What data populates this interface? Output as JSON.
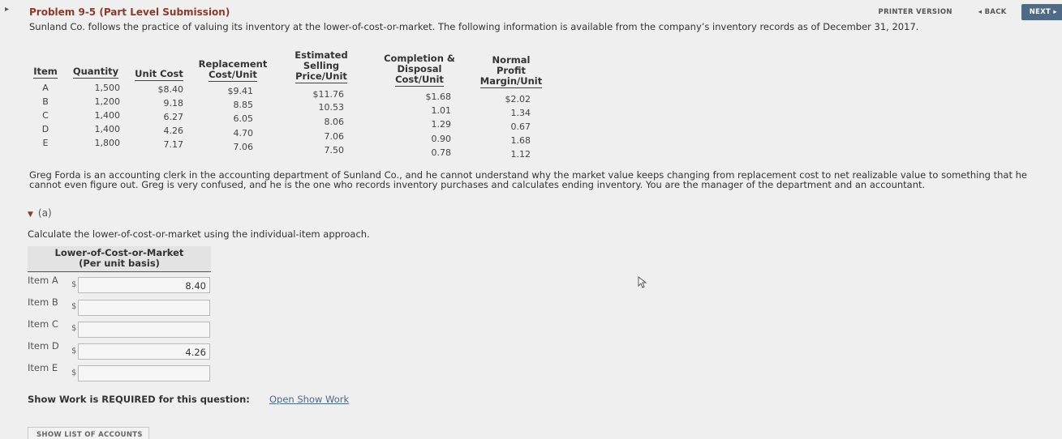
{
  "header": {
    "title": "Problem 9-5 (Part Level Submission)",
    "description": "Sunland Co. follows the practice of valuing its inventory at the lower-of-cost-or-market. The following information is available from the company’s inventory records as of December 31, 2017.",
    "printer_version": "PRINTER VERSION",
    "back": "◂ BACK",
    "next": "NEXT ▸"
  },
  "inventory_table": {
    "headers": {
      "item": "Item",
      "quantity": "Quantity",
      "unit_cost": "Unit Cost",
      "replacement_l1": "Replacement",
      "replacement_l2": "Cost/Unit",
      "esp_l1": "Estimated",
      "esp_l2": "Selling",
      "esp_l3": "Price/Unit",
      "cd_l1": "Completion &",
      "cd_l2": "Disposal",
      "cd_l3": "Cost/Unit",
      "npm_l1": "Normal",
      "npm_l2": "Profit",
      "npm_l3": "Margin/Unit"
    },
    "rows": [
      {
        "item": "A",
        "quantity": "1,500",
        "unit_cost": "$8.40",
        "replacement": "$9.41",
        "esp": "$11.76",
        "cd": "$1.68",
        "npm": "$2.02"
      },
      {
        "item": "B",
        "quantity": "1,200",
        "unit_cost": "9.18",
        "replacement": "8.85",
        "esp": "10.53",
        "cd": "1.01",
        "npm": "1.34"
      },
      {
        "item": "C",
        "quantity": "1,400",
        "unit_cost": "6.27",
        "replacement": "6.05",
        "esp": "8.06",
        "cd": "1.29",
        "npm": "0.67"
      },
      {
        "item": "D",
        "quantity": "1,400",
        "unit_cost": "4.26",
        "replacement": "4.70",
        "esp": "7.06",
        "cd": "0.90",
        "npm": "1.68"
      },
      {
        "item": "E",
        "quantity": "1,800",
        "unit_cost": "7.17",
        "replacement": "7.06",
        "esp": "7.50",
        "cd": "0.78",
        "npm": "1.12"
      }
    ]
  },
  "paragraph": "Greg Forda is an accounting clerk in the accounting department of Sunland Co., and he cannot understand why the market value keeps changing from replacement cost to net realizable value to something that he cannot even figure out. Greg is very confused, and he is the one who records inventory purchases and calculates ending inventory. You are the manager of the department and an accountant.",
  "part_a": {
    "label": "(a)",
    "instruction": "Calculate the lower-of-cost-or-market using the individual-item approach.",
    "table_header_l1": "Lower-of-Cost-or-Market",
    "table_header_l2": "(Per unit basis)",
    "currency": "$",
    "answers": [
      {
        "label": "Item A",
        "value": "8.40"
      },
      {
        "label": "Item B",
        "value": ""
      },
      {
        "label": "Item C",
        "value": ""
      },
      {
        "label": "Item D",
        "value": "4.26"
      },
      {
        "label": "Item E",
        "value": ""
      }
    ]
  },
  "show_work": {
    "label": "Show Work is REQUIRED for this question:",
    "link": "Open Show Work"
  },
  "list_accounts_button": "SHOW LIST OF ACCOUNTS"
}
